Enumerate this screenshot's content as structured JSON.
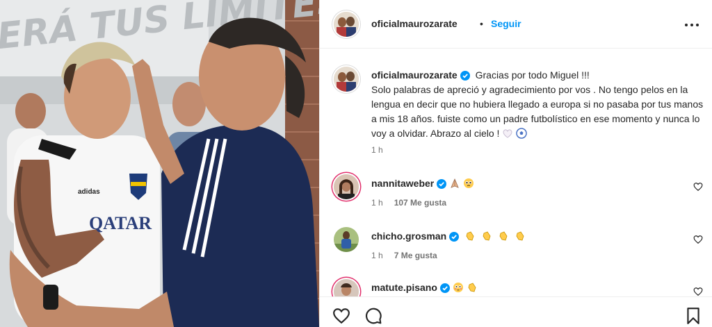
{
  "post": {
    "banner_text": "ERÁ TUS LÍMITES",
    "shirt_sponsor": "QATAR",
    "shirt_brand": "adidas"
  },
  "header": {
    "username": "oficialmaurozarate",
    "separator": "•",
    "follow_label": "Seguir"
  },
  "caption": {
    "username": "oficialmaurozarate",
    "lines": [
      "Gracias por todo Miguel !!!",
      "Solo palabras de apreció y agradecimiento por vos . No tengo pelos en la lengua en decir que no hubiera llegado a europa si no pasaba por tus manos a mis 18 años. fuiste como un padre futbolístico en ese momento y nunca lo voy a olvidar. Abrazo al cielo !"
    ],
    "time": "1 h"
  },
  "comments": [
    {
      "username": "nannitaweber",
      "emojis": [
        "praying-hands",
        "pleading-face"
      ],
      "time": "1 h",
      "likes": "107 Me gusta"
    },
    {
      "username": "chicho.grosman",
      "emojis": [
        "clapping-hands",
        "clapping-hands",
        "clapping-hands",
        "clapping-hands"
      ],
      "time": "1 h",
      "likes": "7 Me gusta"
    },
    {
      "username": "matute.pisano",
      "emojis": [
        "flushed-face",
        "clapping-hands"
      ],
      "time": "",
      "likes": ""
    }
  ],
  "colors": {
    "verified": "#0095f6",
    "follow": "#0095f6",
    "text": "#262626",
    "muted": "#737373",
    "divider": "#efefef"
  },
  "icons": [
    "verified-badge-icon",
    "more-options-icon",
    "heart-icon",
    "comment-icon",
    "bookmark-icon"
  ]
}
